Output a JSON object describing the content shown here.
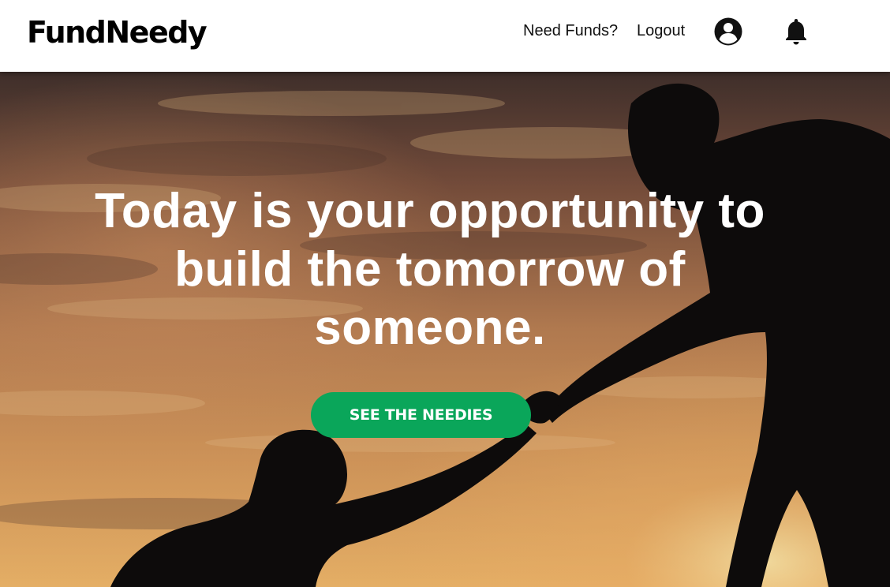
{
  "navbar": {
    "brand": "FundNeedy",
    "links": [
      {
        "label": "Need Funds?"
      },
      {
        "label": "Logout"
      }
    ],
    "icons": [
      "account-circle-icon",
      "bell-icon"
    ]
  },
  "hero": {
    "title": "Today is your opportunity to build the tomorrow of someone.",
    "cta_label": "SEE THE NEEDIES",
    "background": "sunset-silhouette-helping-hand-photo"
  },
  "colors": {
    "cta": "#0aa65a",
    "navbar_bg": "#ffffff",
    "hero_text": "#ffffff"
  }
}
